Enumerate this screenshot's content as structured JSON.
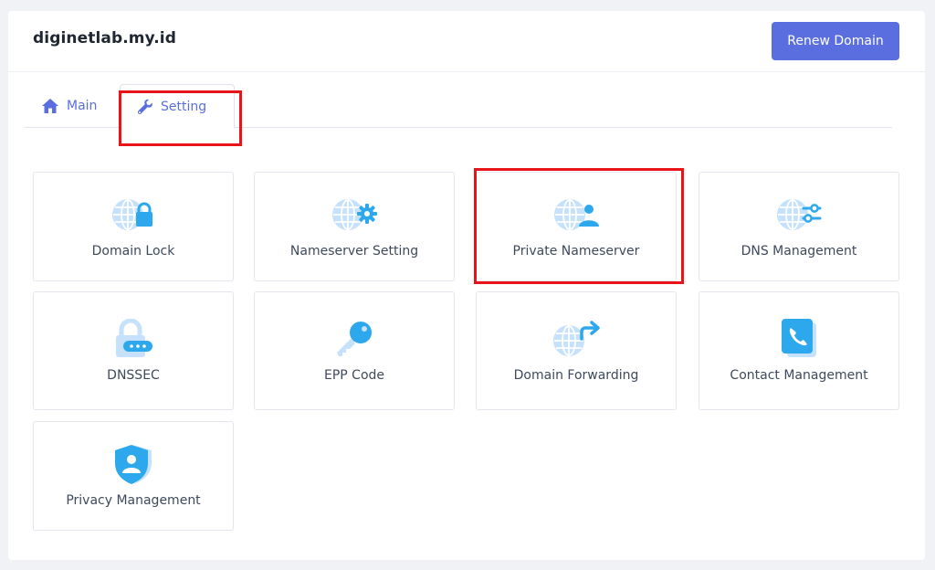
{
  "header": {
    "domain": "diginetlab.my.id",
    "renew_label": "Renew Domain"
  },
  "tabs": [
    {
      "label": "Main",
      "icon": "home-icon",
      "active": false
    },
    {
      "label": "Setting",
      "icon": "wrench-icon",
      "active": true
    }
  ],
  "tiles": [
    {
      "label": "Domain Lock",
      "icon": "globe-lock-icon"
    },
    {
      "label": "Nameserver Setting",
      "icon": "globe-gear-icon"
    },
    {
      "label": "Private Nameserver",
      "icon": "globe-user-icon",
      "highlighted": true
    },
    {
      "label": "DNS Management",
      "icon": "globe-sliders-icon"
    },
    {
      "label": "DNSSEC",
      "icon": "padlock-password-icon"
    },
    {
      "label": "EPP Code",
      "icon": "key-icon"
    },
    {
      "label": "Domain Forwarding",
      "icon": "globe-forward-icon"
    },
    {
      "label": "Contact Management",
      "icon": "phone-book-icon"
    },
    {
      "label": "Privacy Management",
      "icon": "shield-user-icon"
    }
  ],
  "colors": {
    "accent": "#5a6ee0",
    "icon_light": "#c5e1fb",
    "icon_dark": "#2ea8ec",
    "highlight": "#e8141a",
    "background": "#f1f2f6"
  }
}
